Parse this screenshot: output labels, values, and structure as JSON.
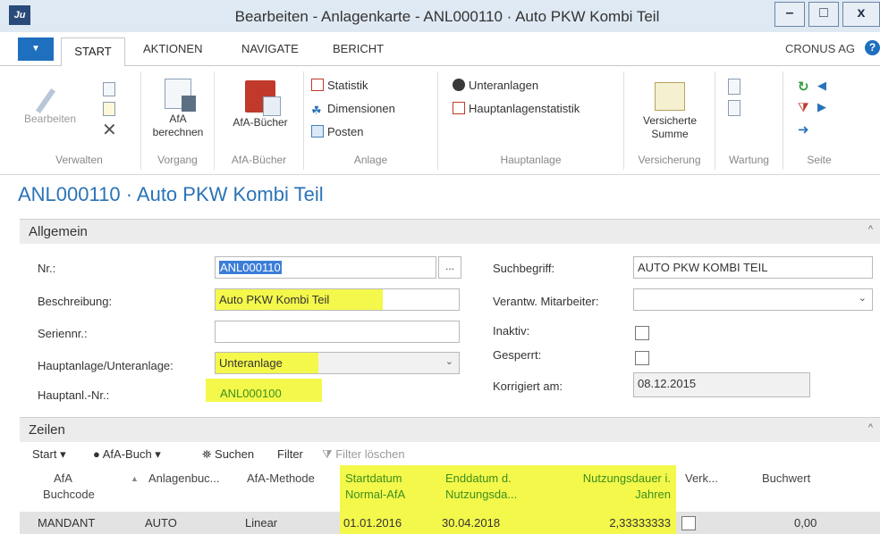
{
  "window": {
    "title": "Bearbeiten - Anlagenkarte - ANL000110 · Auto PKW Kombi Teil",
    "minimize": "–",
    "maximize": "□",
    "close": "x",
    "logo": "Ju"
  },
  "tabs": [
    "START",
    "AKTIONEN",
    "NAVIGATE",
    "BERICHT"
  ],
  "company": "CRONUS AG",
  "ribbon": {
    "groups": [
      {
        "label": "Verwalten",
        "buttons": [
          "Bearbeiten"
        ]
      },
      {
        "label": "Vorgang",
        "buttons": [
          "AfA berechnen"
        ]
      },
      {
        "label": "AfA-Bücher",
        "buttons": [
          "AfA-Bücher"
        ]
      },
      {
        "label": "Anlage",
        "buttons": [
          "Statistik",
          "Dimensionen",
          "Posten"
        ]
      },
      {
        "label": "Hauptanlage",
        "buttons": [
          "Unteranlagen",
          "Hauptanlagenstatistik"
        ]
      },
      {
        "label": "Versicherung",
        "buttons": [
          "Versicherte Summe"
        ]
      },
      {
        "label": "Wartung",
        "buttons": []
      },
      {
        "label": "Seite",
        "buttons": []
      }
    ],
    "afa_line1": "AfA",
    "afa_line2": "berechnen",
    "vs_line1": "Versicherte",
    "vs_line2": "Summe"
  },
  "page_title": "ANL000110 · Auto PKW Kombi Teil",
  "general": {
    "header": "Allgemein",
    "fields": {
      "nr_label": "Nr.:",
      "nr_value": "ANL000110",
      "lookup": "...",
      "beschreibung_label": "Beschreibung:",
      "beschreibung_value": "Auto PKW Kombi Teil",
      "seriennr_label": "Seriennr.:",
      "seriennr_value": "",
      "haupt_unter_label": "Hauptanlage/Unteranlage:",
      "haupt_unter_value": "Unteranlage",
      "hauptanl_nr_label": "Hauptanl.-Nr.:",
      "hauptanl_nr_value": "ANL000100",
      "suchbegriff_label": "Suchbegriff:",
      "suchbegriff_value": "AUTO PKW KOMBI TEIL",
      "verantw_label": "Verantw. Mitarbeiter:",
      "verantw_value": "",
      "inaktiv_label": "Inaktiv:",
      "gesperrt_label": "Gesperrt:",
      "korrigiert_label": "Korrigiert am:",
      "korrigiert_value": "08.12.2015"
    }
  },
  "lines": {
    "header": "Zeilen",
    "toolbar": {
      "start": "Start",
      "afa_buch": "AfA-Buch",
      "suchen": "Suchen",
      "filter": "Filter",
      "filter_loeschen": "Filter löschen"
    },
    "columns": {
      "afa_buchcode_1": "AfA",
      "afa_buchcode_2": "Buchcode",
      "anlagenbuc": "Anlagenbuc...",
      "afa_methode": "AfA-Methode",
      "startdatum_1": "Startdatum",
      "startdatum_2": "Normal-AfA",
      "enddatum_1": "Enddatum d.",
      "enddatum_2": "Nutzungsda...",
      "nutzungsdauer_1": "Nutzungsdauer i.",
      "nutzungsdauer_2": "Jahren",
      "verk": "Verk...",
      "buchwert": "Buchwert"
    },
    "rows": [
      {
        "afa_buchcode": "MANDANT",
        "anlagenbuc": "AUTO",
        "afa_methode": "Linear",
        "startdatum": "01.01.2016",
        "enddatum": "30.04.2018",
        "nutzungsdauer": "2,33333333",
        "buchwert": "0,00"
      }
    ]
  },
  "colors": {
    "accent": "#2a73b8",
    "highlight": "#f4f84a",
    "menu_blue": "#1f6fbf"
  }
}
